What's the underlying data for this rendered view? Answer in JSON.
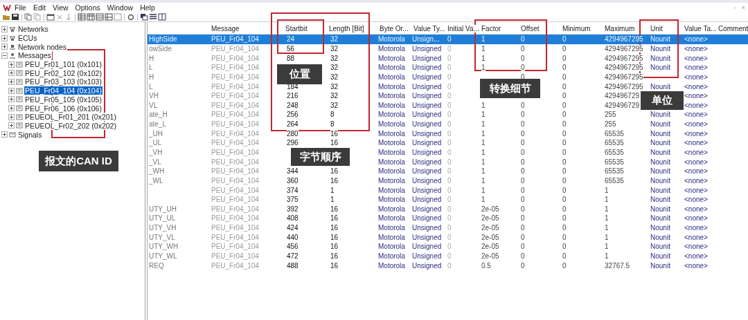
{
  "menu": [
    {
      "label": "File"
    },
    {
      "label": "Edit"
    },
    {
      "label": "View"
    },
    {
      "label": "Options"
    },
    {
      "label": "Window"
    },
    {
      "label": "Help"
    }
  ],
  "window_controls": [
    "-",
    "×"
  ],
  "tree": [
    {
      "label": "Networks",
      "expanded": false
    },
    {
      "label": "ECUs",
      "expanded": false
    },
    {
      "label": "Network nodes",
      "expanded": false
    },
    {
      "label": "Messages",
      "expanded": true,
      "children": [
        {
          "label": "PEU_Fr01_101 (0x101)",
          "expanded": false,
          "selected": false
        },
        {
          "label": "PEU_Fr02_102 (0x102)",
          "expanded": false,
          "selected": false
        },
        {
          "label": "PEU_Fr03_103 (0x103)",
          "expanded": false,
          "selected": false
        },
        {
          "label": "PEU_Fr04_104 (0x104)",
          "expanded": false,
          "selected": true
        },
        {
          "label": "PEU_Fr05_105 (0x105)",
          "expanded": false,
          "selected": false
        },
        {
          "label": "PEU_Fr06_106 (0x106)",
          "expanded": false,
          "selected": false
        },
        {
          "label": "PEUEOL_Fr01_201 (0x201)",
          "expanded": false,
          "selected": false
        },
        {
          "label": "PEUEOL_Fr02_202 (0x202)",
          "expanded": false,
          "selected": false
        }
      ]
    },
    {
      "label": "Signals",
      "expanded": false
    }
  ],
  "table": {
    "columns": [
      "",
      "Message",
      "Startbit",
      "Length [Bit]",
      "Byte Or...",
      "Value Ty...",
      "Initial Va...",
      "Factor",
      "Offset",
      "Minimum",
      "Maximum",
      "Unit",
      "Value Ta...",
      "Comment"
    ],
    "rows": [
      {
        "selected": true,
        "cells": [
          "HighSide",
          "PEU_Fr04_104",
          "24",
          "32",
          "Motorola",
          "Unsign...",
          "0",
          "1",
          "0",
          "0",
          "4294967295",
          "Nounit",
          "<none>"
        ]
      },
      {
        "selected": false,
        "cells": [
          "owSide",
          "PEU_Fr04_104",
          "56",
          "32",
          "Motorola",
          "Unsigned",
          "0",
          "1",
          "0",
          "0",
          "4294967295",
          "Nounit",
          "<none>"
        ]
      },
      {
        "selected": false,
        "cells": [
          "H",
          "PEU_Fr04_104",
          "88",
          "32",
          "Motorola",
          "Unsigned",
          "0",
          "1",
          "0",
          "0",
          "4294967295",
          "Nounit",
          "<none>"
        ]
      },
      {
        "selected": false,
        "cells": [
          "L",
          "PEU_Fr04_104",
          null,
          "32",
          "Motorola",
          "Unsigned",
          "0",
          "1",
          "0",
          "0",
          "4294967295",
          "Nounit",
          "<none>"
        ]
      },
      {
        "selected": false,
        "cells": [
          "H",
          "PEU_Fr04_104",
          null,
          "32",
          "Motorola",
          "Unsigned",
          "0",
          null,
          "0",
          "0",
          "4294967295",
          null,
          "<none>"
        ]
      },
      {
        "selected": false,
        "cells": [
          "L",
          "PEU_Fr04_104",
          "184",
          "32",
          "Motorola",
          "Unsigned",
          "0",
          null,
          null,
          "0",
          "4294967295",
          "Nounit",
          "<none>"
        ]
      },
      {
        "selected": false,
        "cells": [
          "VH",
          "PEU_Fr04_104",
          "216",
          "32",
          "Motorola",
          "Unsigned",
          "0",
          null,
          null,
          "0",
          "429496729",
          null,
          "<none>"
        ]
      },
      {
        "selected": false,
        "cells": [
          "VL",
          "PEU_Fr04_104",
          "248",
          "32",
          "Motorola",
          "Unsigned",
          "0",
          "1",
          "0",
          "0",
          "429496729",
          null,
          "<none>"
        ]
      },
      {
        "selected": false,
        "cells": [
          "ate_H",
          "PEU_Fr04_104",
          "256",
          "8",
          "Motorola",
          "Unsigned",
          "0",
          "1",
          "0",
          "0",
          "255",
          "Nounit",
          "<none>"
        ]
      },
      {
        "selected": false,
        "cells": [
          "ate_L",
          "PEU_Fr04_104",
          "264",
          "8",
          "Motorola",
          "Unsigned",
          "0",
          "1",
          "0",
          "0",
          "255",
          "Nounit",
          "<none>"
        ]
      },
      {
        "selected": false,
        "cells": [
          "_UH",
          "PEU_Fr04_104",
          "280",
          "16",
          "Motorola",
          "Unsigned",
          "0",
          "1",
          "0",
          "0",
          "65535",
          "Nounit",
          "<none>"
        ]
      },
      {
        "selected": false,
        "cells": [
          "_UL",
          "PEU_Fr04_104",
          "296",
          "16",
          "Motorola",
          "Unsigned",
          "0",
          "1",
          "0",
          "0",
          "65535",
          "Nounit",
          "<none>"
        ]
      },
      {
        "selected": false,
        "cells": [
          "_VH",
          "PEU_Fr04_104",
          null,
          null,
          "Motorola",
          "Unsigned",
          "0",
          "1",
          "0",
          "0",
          "65535",
          "Nounit",
          "<none>"
        ]
      },
      {
        "selected": false,
        "cells": [
          "_VL",
          "PEU_Fr04_104",
          null,
          null,
          "Motorola",
          "Unsigned",
          "0",
          "1",
          "0",
          "0",
          "65535",
          "Nounit",
          "<none>"
        ]
      },
      {
        "selected": false,
        "cells": [
          "_WH",
          "PEU_Fr04_104",
          "344",
          "16",
          "Motorola",
          "Unsigned",
          "0",
          "1",
          "0",
          "0",
          "65535",
          "Nounit",
          "<none>"
        ]
      },
      {
        "selected": false,
        "cells": [
          "_WL",
          "PEU_Fr04_104",
          "360",
          "16",
          "Motorola",
          "Unsigned",
          "0",
          "1",
          "0",
          "0",
          "65535",
          "Nounit",
          "<none>"
        ]
      },
      {
        "selected": false,
        "cells": [
          null,
          "PEU_Fr04_104",
          "374",
          "1",
          "Motorola",
          "Unsigned",
          "0",
          "1",
          "0",
          "0",
          "1",
          "Nounit",
          "<none>"
        ]
      },
      {
        "selected": false,
        "cells": [
          null,
          "PEU_Fr04_104",
          "375",
          "1",
          "Motorola",
          "Unsigned",
          "0",
          "1",
          "0",
          "0",
          "1",
          "Nounit",
          "<none>"
        ]
      },
      {
        "selected": false,
        "cells": [
          "UTY_UH",
          "PEU_Fr04_104",
          "392",
          "16",
          "Motorola",
          "Unsigned",
          "0",
          "2e-05",
          "0",
          "0",
          "1",
          "Nounit",
          "<none>"
        ]
      },
      {
        "selected": false,
        "cells": [
          "UTY_UL",
          "PEU_Fr04_104",
          "408",
          "16",
          "Motorola",
          "Unsigned",
          "0",
          "2e-05",
          "0",
          "0",
          "1",
          "Nounit",
          "<none>"
        ]
      },
      {
        "selected": false,
        "cells": [
          "UTY_VH",
          "PEU_Fr04_104",
          "424",
          "16",
          "Motorola",
          "Unsigned",
          "0",
          "2e-05",
          "0",
          "0",
          "1",
          "Nounit",
          "<none>"
        ]
      },
      {
        "selected": false,
        "cells": [
          "UTY_VL",
          "PEU_Fr04_104",
          "440",
          "16",
          "Motorola",
          "Unsigned",
          "0",
          "2e-05",
          "0",
          "0",
          "1",
          "Nounit",
          "<none>"
        ]
      },
      {
        "selected": false,
        "cells": [
          "UTY_WH",
          "PEU_Fr04_104",
          "456",
          "16",
          "Motorola",
          "Unsigned",
          "0",
          "2e-05",
          "0",
          "0",
          "1",
          "Nounit",
          "<none>"
        ]
      },
      {
        "selected": false,
        "cells": [
          "UTY_WL",
          "PEU_Fr04_104",
          "472",
          "16",
          "Motorola",
          "Unsigned",
          "0",
          "2e-05",
          "0",
          "0",
          "1",
          "Nounit",
          "<none>"
        ]
      },
      {
        "selected": false,
        "cells": [
          "REQ",
          "PEU_Fr04_104",
          "488",
          "16",
          "Motorola",
          "Unsigned",
          "0",
          "0.5",
          "0",
          "0",
          "32767.5",
          "Nounit",
          "<none>"
        ]
      }
    ]
  },
  "annotations": [
    {
      "kind": "box"
    },
    {
      "kind": "box"
    },
    {
      "kind": "box"
    },
    {
      "kind": "box"
    },
    {
      "kind": "box"
    },
    {
      "kind": "label",
      "text": "报文的CAN ID"
    },
    {
      "kind": "label",
      "text": "位置"
    },
    {
      "kind": "label",
      "text": "字节顺序"
    },
    {
      "kind": "label",
      "text": "转换细节"
    },
    {
      "kind": "label",
      "text": "单位"
    }
  ]
}
